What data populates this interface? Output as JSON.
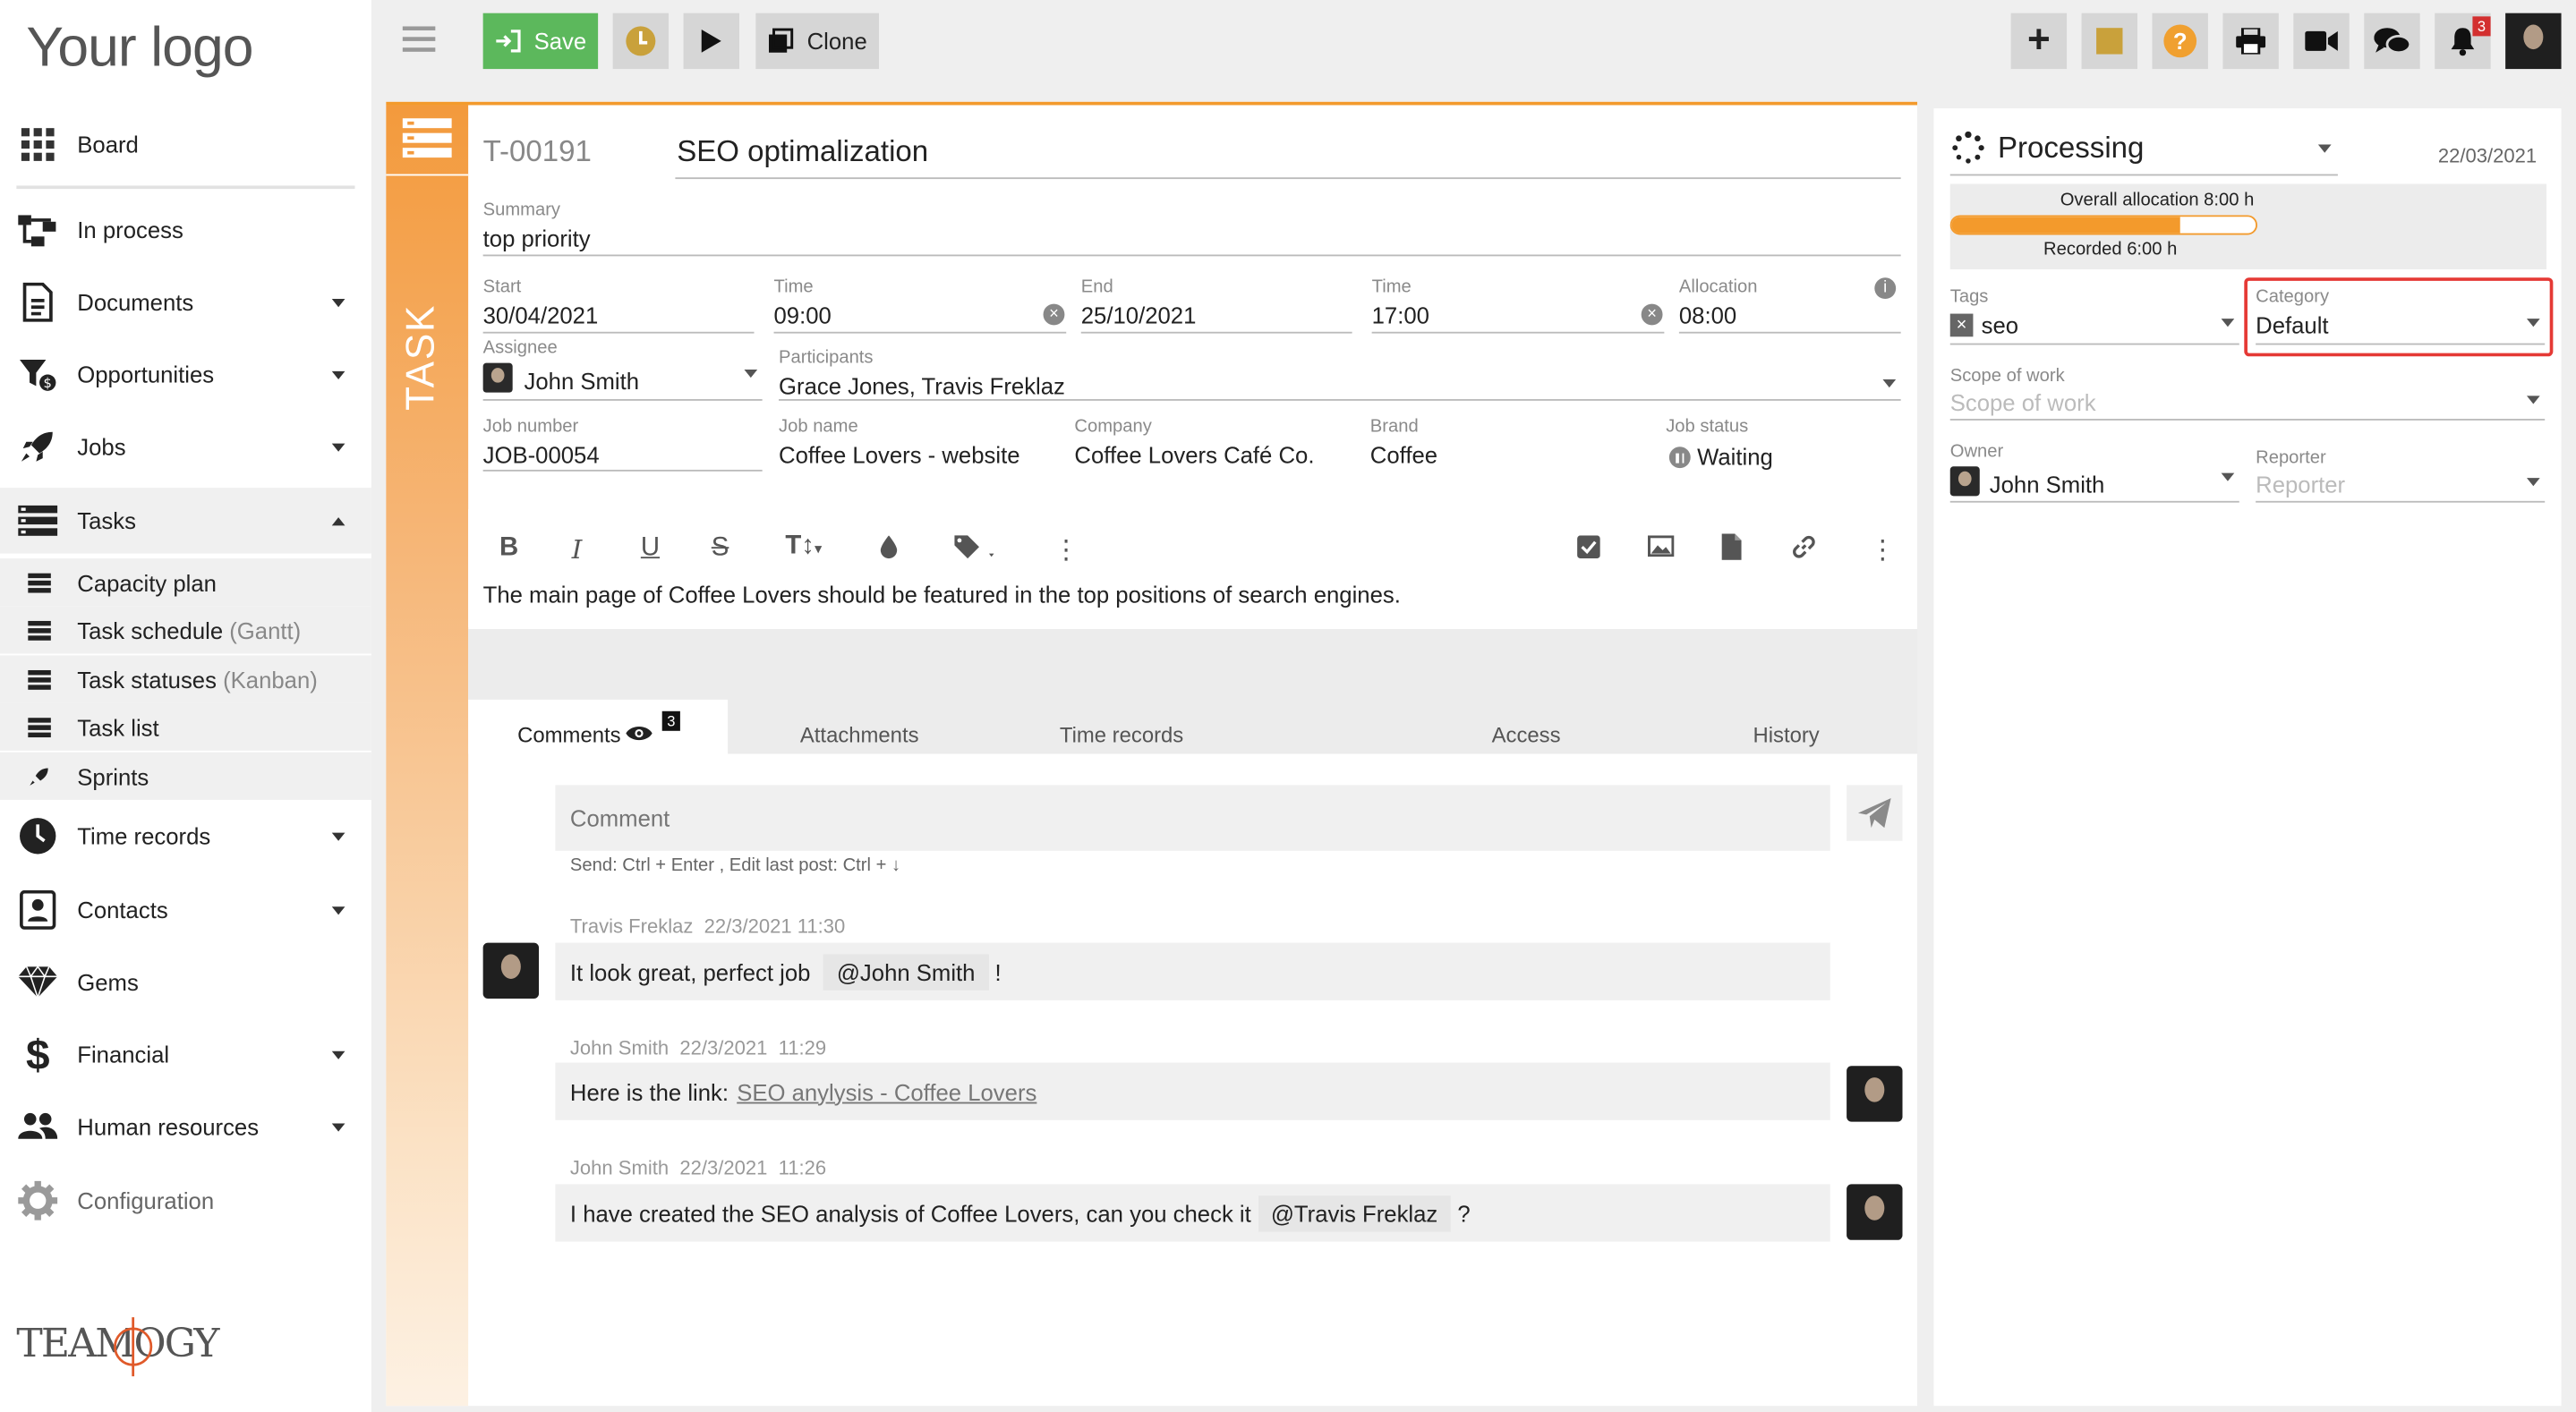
{
  "logo": "Your logo",
  "brand_footer": "TEAMOGY",
  "sidebar": {
    "items": [
      {
        "label": "Board",
        "icon": "grid-icon",
        "caret": ""
      },
      {
        "label": "In process",
        "icon": "workflow-icon",
        "caret": ""
      },
      {
        "label": "Documents",
        "icon": "document-icon",
        "caret": "down"
      },
      {
        "label": "Opportunities",
        "icon": "funnel-icon",
        "caret": "down"
      },
      {
        "label": "Jobs",
        "icon": "rocket-icon",
        "caret": "down"
      },
      {
        "label": "Tasks",
        "icon": "tasks-icon",
        "caret": "up"
      }
    ],
    "sub_items": [
      {
        "label": "Capacity plan",
        "hint": ""
      },
      {
        "label": "Task schedule",
        "hint": "(Gantt)"
      },
      {
        "label": "Task statuses",
        "hint": "(Kanban)"
      },
      {
        "label": "Task list",
        "hint": ""
      },
      {
        "label": "Sprints",
        "hint": ""
      }
    ],
    "items2": [
      {
        "label": "Time records",
        "icon": "clock-icon",
        "caret": "down"
      },
      {
        "label": "Contacts",
        "icon": "contacts-icon",
        "caret": "down"
      },
      {
        "label": "Gems",
        "icon": "gem-icon",
        "caret": ""
      },
      {
        "label": "Financial",
        "icon": "dollar-icon",
        "caret": "down"
      },
      {
        "label": "Human resources",
        "icon": "people-icon",
        "caret": "down"
      },
      {
        "label": "Configuration",
        "icon": "gear-icon",
        "caret": ""
      }
    ]
  },
  "toolbar": {
    "save_label": "Save",
    "clone_label": "Clone",
    "notification_count": "3"
  },
  "task": {
    "side_label": "TASK",
    "id": "T-00191",
    "title": "SEO optimalization",
    "summary_label": "Summary",
    "summary": "top priority",
    "start_label": "Start",
    "start": "30/04/2021",
    "time_label": "Time",
    "start_time": "09:00",
    "end_label": "End",
    "end": "25/10/2021",
    "end_time": "17:00",
    "allocation_label": "Allocation",
    "allocation": "08:00",
    "assignee_label": "Assignee",
    "assignee": "John Smith",
    "participants_label": "Participants",
    "participants": "Grace Jones, Travis Freklaz",
    "job_number_label": "Job number",
    "job_number": "JOB-00054",
    "job_name_label": "Job name",
    "job_name": "Coffee Lovers - website",
    "company_label": "Company",
    "company": "Coffee Lovers Café Co.",
    "brand_label": "Brand",
    "brand": "Coffee",
    "job_status_label": "Job status",
    "job_status": "Waiting",
    "description": "The main page of Coffee Lovers should be featured in the top positions of search engines."
  },
  "tabs": {
    "comments": "Comments",
    "comments_count": "3",
    "attachments": "Attachments",
    "time_records": "Time records",
    "access": "Access",
    "history": "History"
  },
  "comment_box": {
    "placeholder": "Comment",
    "hint": "Send: Ctrl + Enter , Edit last post: Ctrl + ↓"
  },
  "comments": [
    {
      "author": "Travis Freklaz",
      "date": "22/3/2021",
      "time": "11:30",
      "text_before": "It look great, perfect job",
      "mention": "@John Smith",
      "text_after": "!"
    },
    {
      "author": "John Smith",
      "date": "22/3/2021",
      "time": "11:29",
      "text_before": "Here is the link:",
      "link": "SEO anylysis - Coffee Lovers"
    },
    {
      "author": "John Smith",
      "date": "22/3/2021",
      "time": "11:26",
      "text_before": "I have created the SEO analysis of Coffee Lovers, can you check it",
      "mention": "@Travis Freklaz",
      "text_after": "?"
    }
  ],
  "status_panel": {
    "status": "Processing",
    "date": "22/03/2021",
    "overall_allocation": "Overall allocation 8:00 h",
    "recorded": "Recorded 6:00 h",
    "recorded_fraction": 0.75,
    "tags_label": "Tags",
    "tag": "seo",
    "category_label": "Category",
    "category": "Default",
    "scope_label": "Scope of work",
    "scope_placeholder": "Scope of work",
    "owner_label": "Owner",
    "owner": "John Smith",
    "reporter_label": "Reporter",
    "reporter_placeholder": "Reporter"
  },
  "colors": {
    "accent": "#f39a2c",
    "save_green": "#5cb85c",
    "highlight_red": "#e53935",
    "badge_red": "#d32f2f"
  }
}
